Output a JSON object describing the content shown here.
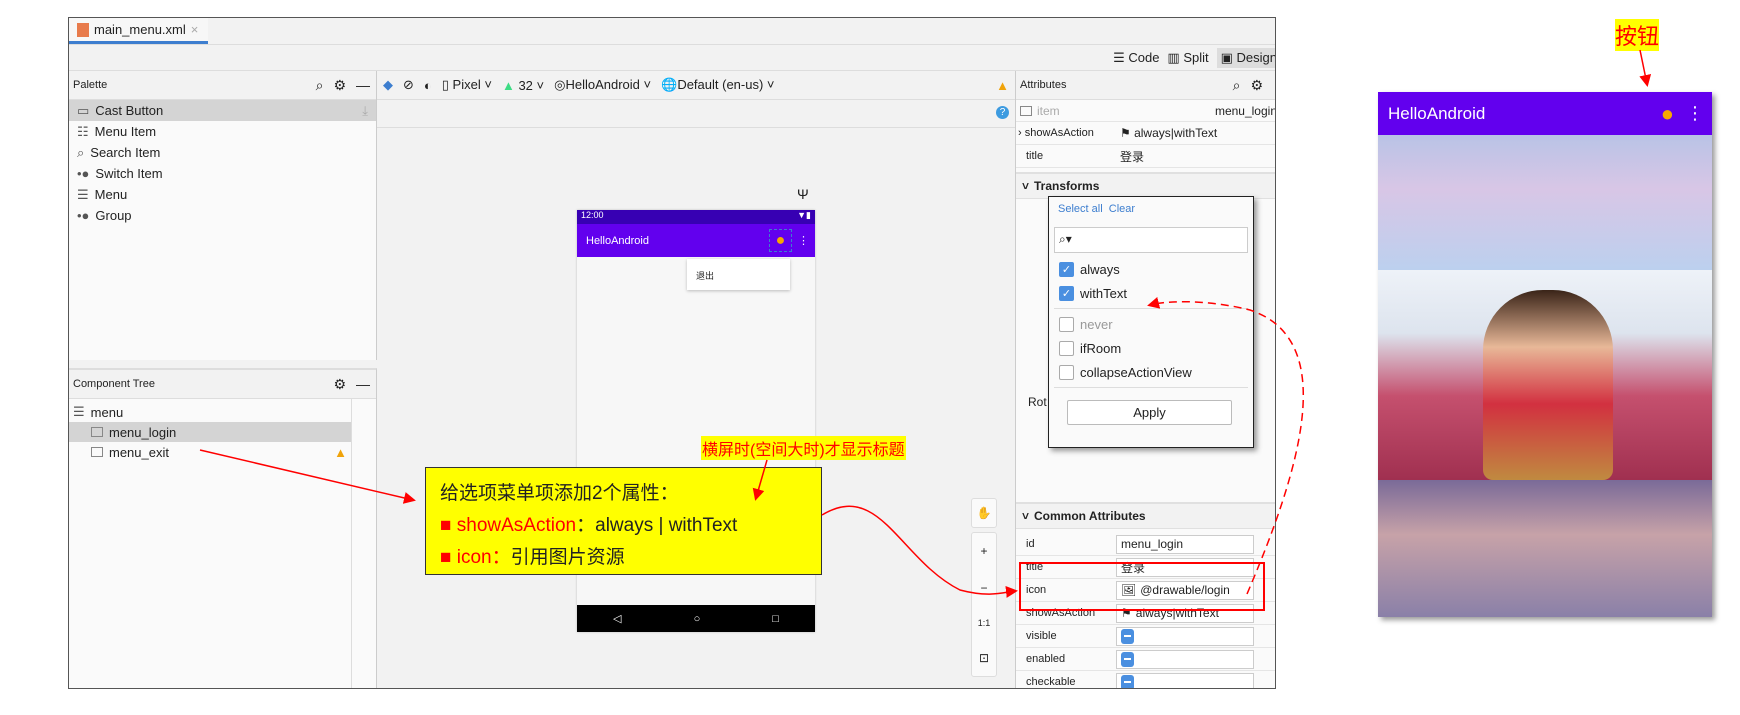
{
  "editor": {
    "tab": "main_menu.xml",
    "view_modes": [
      "Code",
      "Split",
      "Design"
    ]
  },
  "palette": {
    "title": "Palette",
    "items": [
      "Cast Button",
      "Menu Item",
      "Search Item",
      "Switch Item",
      "Menu",
      "Group"
    ]
  },
  "design_toolbar": {
    "device": "Pixel",
    "api": "32",
    "theme": "HelloAndroid",
    "locale": "Default (en-us)"
  },
  "preview": {
    "time": "12:00",
    "app_title": "HelloAndroid",
    "overflow_item": "退出"
  },
  "component_tree": {
    "title": "Component Tree",
    "root": "menu",
    "items": [
      "menu_login",
      "menu_exit"
    ]
  },
  "attributes": {
    "title": "Attributes",
    "item_label": "item",
    "item_id": "menu_login",
    "declared": [
      {
        "key": "showAsAction",
        "value": "always|withText"
      },
      {
        "key": "title",
        "value": "登录"
      }
    ],
    "transforms": "Transforms",
    "rot_label": "Rot",
    "popup": {
      "select_all": "Select all",
      "clear": "Clear",
      "options": [
        {
          "label": "always",
          "checked": true
        },
        {
          "label": "withText",
          "checked": true
        },
        {
          "label": "never",
          "checked": false
        },
        {
          "label": "ifRoom",
          "checked": false
        },
        {
          "label": "collapseActionView",
          "checked": false
        }
      ],
      "apply": "Apply"
    },
    "common": "Common Attributes",
    "common_rows": [
      {
        "key": "id",
        "value": "menu_login"
      },
      {
        "key": "title",
        "value": "登录"
      },
      {
        "key": "icon",
        "value": "@drawable/login"
      },
      {
        "key": "showAsAction",
        "value": "always|withText"
      },
      {
        "key": "visible",
        "value": ""
      },
      {
        "key": "enabled",
        "value": ""
      },
      {
        "key": "checkable",
        "value": ""
      }
    ]
  },
  "zoom_controls": {
    "ratio": "1:1"
  },
  "annotations": {
    "callout_title": "给选项菜单项添加2个属性：",
    "line1_key": "showAsAction",
    "line1_sep": "：",
    "line1_val": "always | withText",
    "line2_key": "icon",
    "line2_sep": "：",
    "line2_val": "引用图片资源",
    "landscape_note": "横屏时(空间大时)才显示标题",
    "button_label": "按钮",
    "highlight_color": "#ffff00",
    "arrow_color": "#ff0000"
  },
  "result_phone": {
    "app_title": "HelloAndroid",
    "appbar_color": "#6200ee"
  }
}
